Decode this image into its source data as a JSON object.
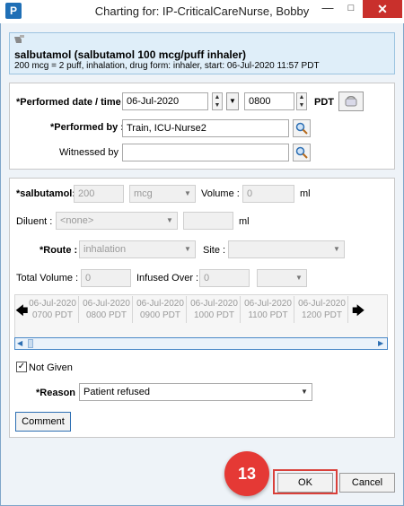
{
  "window": {
    "title": "Charting for: IP-CriticalCareNurse, Bobby",
    "app_icon": "P"
  },
  "medication": {
    "name": "salbutamol (salbutamol 100 mcg/puff inhaler)",
    "detail": "200 mcg = 2 puff, inhalation, drug form: inhaler, start: 06-Jul-2020 11:57 PDT"
  },
  "performed": {
    "date_label": "*Performed date / time :",
    "date_value": "06-Jul-2020",
    "time_value": "0800",
    "timezone": "PDT",
    "by_label": "*Performed by :",
    "by_value": "Train, ICU-Nurse2",
    "witness_label": "Witnessed by :",
    "witness_value": ""
  },
  "dose": {
    "label": "*salbutamol:",
    "value": "200",
    "unit": "mcg",
    "volume_label": "Volume :",
    "volume_value": "0",
    "volume_unit": "ml"
  },
  "diluent": {
    "label": "Diluent :",
    "value": "<none>",
    "amount": "",
    "unit": "ml"
  },
  "route": {
    "label": "*Route :",
    "value": "inhalation",
    "site_label": "Site :",
    "site_value": ""
  },
  "totals": {
    "total_volume_label": "Total Volume :",
    "total_volume_value": "0",
    "infused_over_label": "Infused Over :",
    "infused_over_value": "0",
    "infused_unit": ""
  },
  "timeline": [
    {
      "date": "06-Jul-2020",
      "time": "0700 PDT"
    },
    {
      "date": "06-Jul-2020",
      "time": "0800 PDT"
    },
    {
      "date": "06-Jul-2020",
      "time": "0900 PDT"
    },
    {
      "date": "06-Jul-2020",
      "time": "1000 PDT"
    },
    {
      "date": "06-Jul-2020",
      "time": "1100 PDT"
    },
    {
      "date": "06-Jul-2020",
      "time": "1200 PDT"
    }
  ],
  "not_given": {
    "label": "Not Given",
    "checked": true
  },
  "reason": {
    "label": "*Reason :",
    "value": "Patient refused"
  },
  "buttons": {
    "comment": "Comment",
    "ok": "OK",
    "cancel": "Cancel"
  },
  "step_badge": "13",
  "colors": {
    "accent": "#1f6fb6",
    "badge": "#e53935",
    "highlight": "#d9403a"
  }
}
